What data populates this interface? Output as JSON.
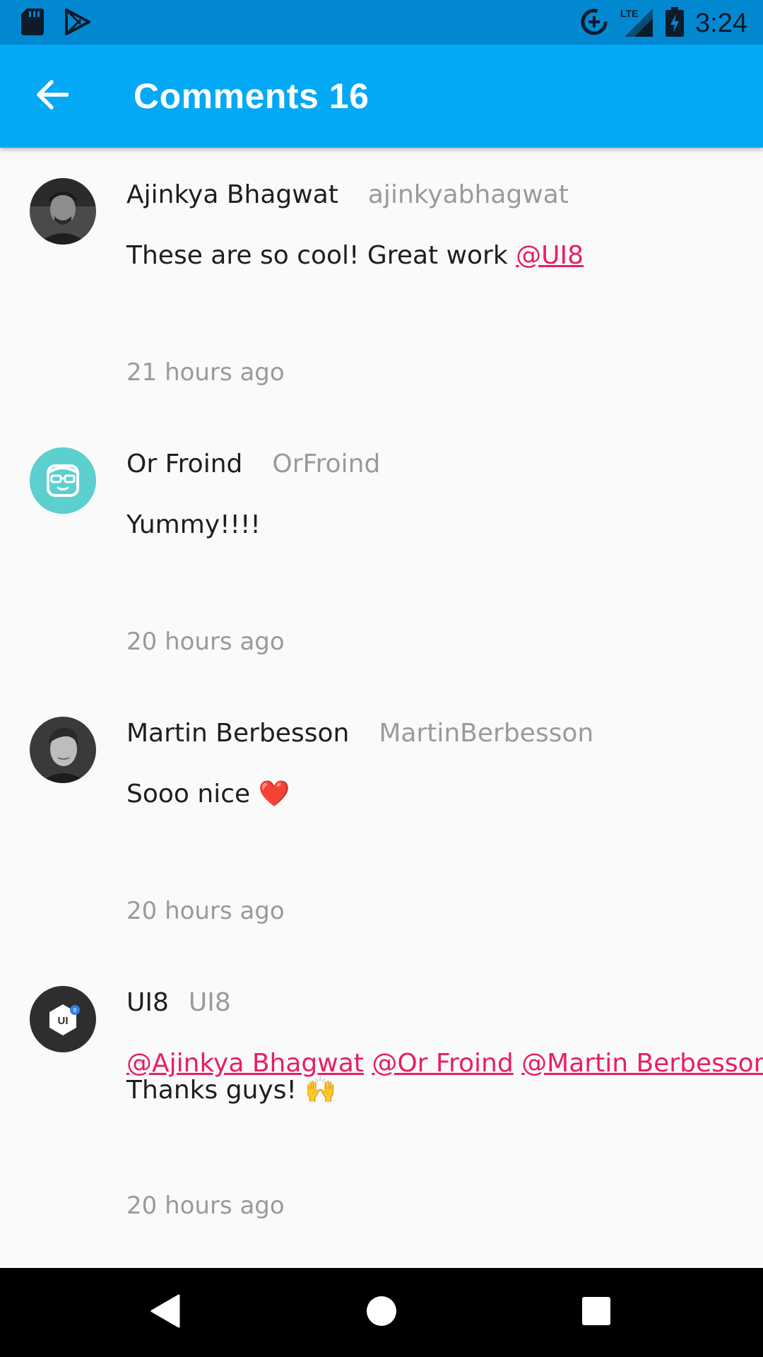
{
  "status_bar": {
    "time": "3:24",
    "icons": [
      "sd-card-icon",
      "play-store-icon",
      "data-saver-icon",
      "lte-signal-icon",
      "battery-charging-icon"
    ]
  },
  "app_bar": {
    "back_icon": "arrow-back-icon",
    "title": "Comments 16",
    "color": "#03a9f4"
  },
  "comments": [
    {
      "display_name": "Ajinkya Bhagwat",
      "username": "ajinkyabhagwat",
      "text": "These are so cool! Great work ",
      "mention": "@UI8",
      "time": "21 hours ago"
    },
    {
      "display_name": "Or Froind",
      "username": "OrFroind",
      "text": "Yummy!!!!",
      "time": "20 hours ago"
    },
    {
      "display_name": "Martin Berbesson",
      "username": "MartinBerbesson",
      "text": "Sooo nice ",
      "emoji": "❤️",
      "time": "20 hours ago"
    },
    {
      "display_name": "UI8",
      "username": "UI8",
      "mentions": [
        "@Ajinkya Bhagwat",
        "@Or Froind",
        "@Martin Berbesson"
      ],
      "text": "Thanks guys! ",
      "emoji": "🙌",
      "time": "20 hours ago"
    }
  ],
  "colors": {
    "mention": "#e91e63",
    "secondary_text": "#9a9a9a"
  },
  "nav_bar": {
    "icons": [
      "back-triangle-icon",
      "home-circle-icon",
      "recents-square-icon"
    ]
  }
}
